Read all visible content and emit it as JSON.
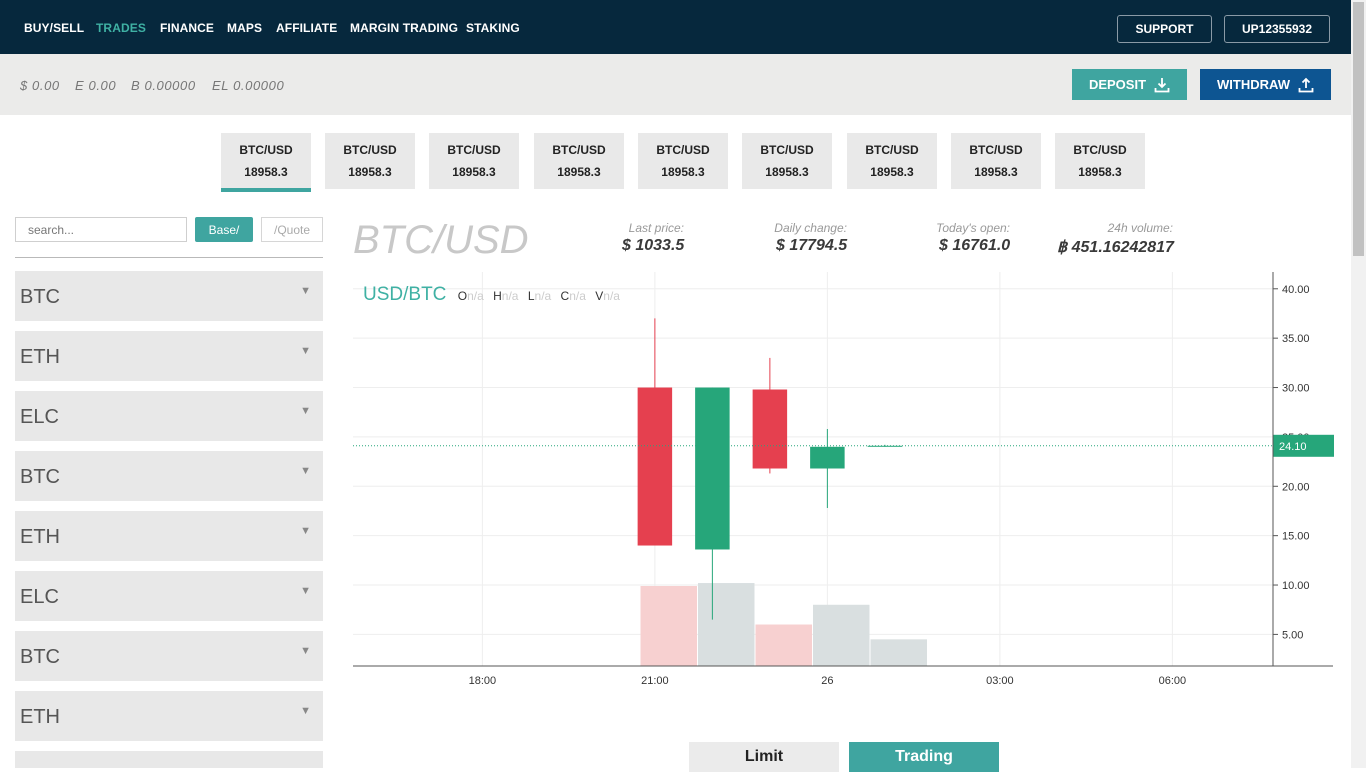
{
  "nav": {
    "items": [
      {
        "label": "BUY/SELL",
        "active": false
      },
      {
        "label": "TRADES",
        "active": true
      },
      {
        "label": "FINANCE",
        "active": false
      },
      {
        "label": "MAPS",
        "active": false
      },
      {
        "label": "AFFILIATE",
        "active": false
      },
      {
        "label": "MARGIN TRADING",
        "active": false
      },
      {
        "label": "STAKING",
        "active": false
      }
    ],
    "support_label": "SUPPORT",
    "account_label": "UP12355932"
  },
  "balances": {
    "usd": "$ 0.00",
    "eth": "E 0.00",
    "btc": "B 0.00000",
    "elc": "EL 0.00000"
  },
  "actions": {
    "deposit_label": "DEPOSIT",
    "withdraw_label": "WITHDRAW"
  },
  "pair_tabs": [
    {
      "name": "BTC/USD",
      "price": "18958.3"
    },
    {
      "name": "BTC/USD",
      "price": "18958.3"
    },
    {
      "name": "BTC/USD",
      "price": "18958.3"
    },
    {
      "name": "BTC/USD",
      "price": "18958.3"
    },
    {
      "name": "BTC/USD",
      "price": "18958.3"
    },
    {
      "name": "BTC/USD",
      "price": "18958.3"
    },
    {
      "name": "BTC/USD",
      "price": "18958.3"
    },
    {
      "name": "BTC/USD",
      "price": "18958.3"
    },
    {
      "name": "BTC/USD",
      "price": "18958.3"
    }
  ],
  "sidebar": {
    "search_placeholder": "search...",
    "base_label": "Base/",
    "quote_label": "/Quote",
    "coins": [
      "BTC",
      "ETH",
      "ELC",
      "BTC",
      "ETH",
      "ELC",
      "BTC",
      "ETH",
      ""
    ]
  },
  "market": {
    "pair": "BTC/USD",
    "last_price_label": "Last price:",
    "last_price": "$ 1033.5",
    "daily_change_label": "Daily change:",
    "daily_change": "$ 17794.5",
    "todays_open_label": "Today's open:",
    "todays_open": "$ 16761.0",
    "volume_label": "24h volume:",
    "volume": "฿ 451.16242817"
  },
  "chart_legend": {
    "pair": "USD/BTC",
    "o_label": "O",
    "h_label": "H",
    "l_label": "L",
    "c_label": "C",
    "v_label": "V",
    "na": "n/a"
  },
  "chart_data": {
    "type": "candlestick",
    "x_ticks": [
      "18:00",
      "21:00",
      "26",
      "03:00",
      "06:00"
    ],
    "y_ticks": [
      "40.00",
      "35.00",
      "30.00",
      "25.00",
      "20.00",
      "15.00",
      "10.00",
      "5.00"
    ],
    "ylim": [
      1.8,
      41.7
    ],
    "x_domain_hours": [
      15.75,
      31.75
    ],
    "x_tick_hours": [
      18,
      21,
      24,
      27,
      30
    ],
    "current_price": "24.10",
    "current_price_value": 24.1,
    "candles": [
      {
        "t": 21.0,
        "open": 30.0,
        "high": 37.0,
        "low": 14.0,
        "close": 14.0,
        "dir": "down"
      },
      {
        "t": 22.0,
        "open": 13.6,
        "high": 30.0,
        "low": 6.5,
        "close": 30.0,
        "dir": "up"
      },
      {
        "t": 23.0,
        "open": 29.8,
        "high": 33.0,
        "low": 21.3,
        "close": 21.8,
        "dir": "down"
      },
      {
        "t": 24.0,
        "open": 21.8,
        "high": 25.8,
        "low": 17.8,
        "close": 24.0,
        "dir": "up"
      },
      {
        "t": 25.0,
        "open": 24.1,
        "high": 24.2,
        "low": 24.0,
        "close": 24.1,
        "dir": "flat"
      }
    ],
    "volumes": [
      {
        "t": 20.75,
        "value": 8.1,
        "dir": "down"
      },
      {
        "t": 21.75,
        "value": 8.4,
        "dir": "up"
      },
      {
        "t": 22.75,
        "value": 4.2,
        "dir": "down"
      },
      {
        "t": 23.75,
        "value": 6.2,
        "dir": "up"
      },
      {
        "t": 24.75,
        "value": 2.7,
        "dir": "up"
      }
    ],
    "colors": {
      "up": "#26a67a",
      "down": "#e5404f",
      "vol_up": "#d9dfe0",
      "vol_down": "#f7d0d0",
      "price_tag": "#26a67a",
      "grid": "#eeeeee"
    }
  },
  "order_tabs": {
    "limit_label": "Limit",
    "trading_label": "Trading"
  },
  "colors": {
    "nav_bg": "#06283d",
    "accent": "#3fa5a0",
    "withdraw_bg": "#0d5592"
  }
}
